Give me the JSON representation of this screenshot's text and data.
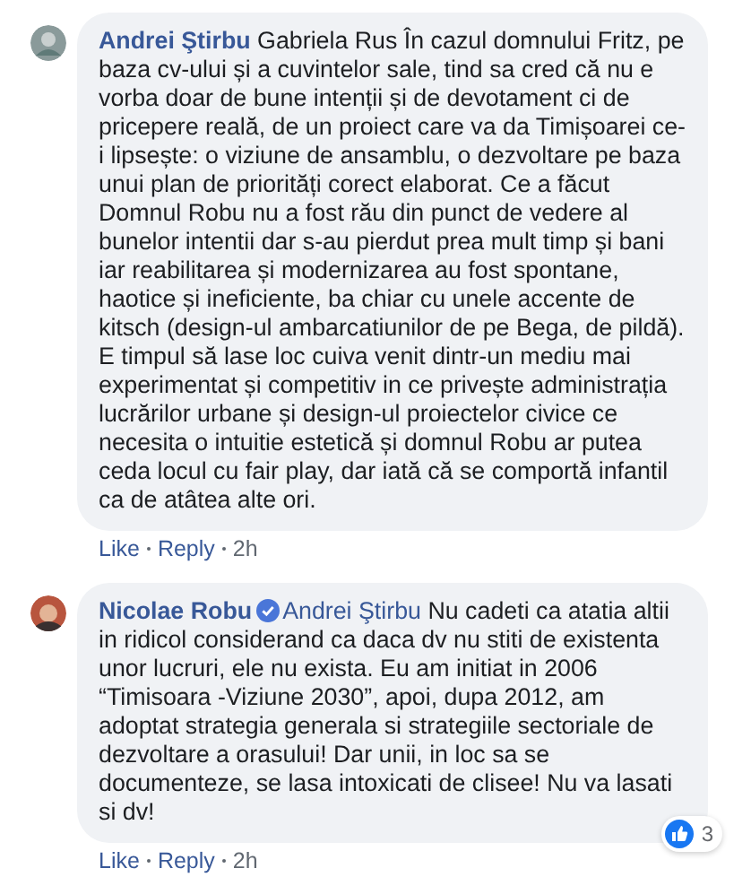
{
  "comments": [
    {
      "author": "Andrei Ştirbu",
      "verified": false,
      "text": "Gabriela Rus În cazul domnului Fritz, pe baza cv-ului și a cuvintelor sale, tind sa cred că nu e vorba doar de bune intenții și de devotament ci de pricepere reală, de un proiect care va da Timișoarei ce-i lipsește: o viziune de ansamblu, o dezvoltare pe baza unui plan de priorități corect elaborat. Ce a făcut Domnul Robu nu a fost rău din punct de vedere al bunelor intentii dar s-au pierdut prea mult timp și bani iar reabilitarea și modernizarea au fost spontane, haotice și ineficiente, ba chiar cu unele accente de kitsch (design-ul ambarcatiunilor de pe Bega, de pildă). E timpul să lase loc cuiva venit dintr-un mediu mai experimentat și competitiv in ce privește administrația lucrărilor urbane și design-ul proiectelor civice ce necesita o intuitie estetică și domnul Robu ar putea ceda locul cu fair play, dar iată că se comportă infantil ca de atâtea alte ori.",
      "actions": [
        "Like",
        "Reply"
      ],
      "time": "2h"
    },
    {
      "author": "Nicolae Robu",
      "verified": true,
      "mention": "Andrei Ştirbu",
      "text": "Nu cadeti ca atatia altii in ridicol considerand ca daca dv nu stiti de existenta unor lucruri, ele nu exista. Eu am initiat in 2006 “Timisoara -Viziune 2030”, apoi, dupa 2012, am adoptat strategia generala si strategiile sectoriale de dezvoltare a orasului! Dar unii, in loc sa se documenteze, se lasa intoxicati de clisee! Nu va lasati si dv!",
      "reactions": "3",
      "actions": [
        "Like",
        "Reply"
      ],
      "time": "2h"
    }
  ]
}
